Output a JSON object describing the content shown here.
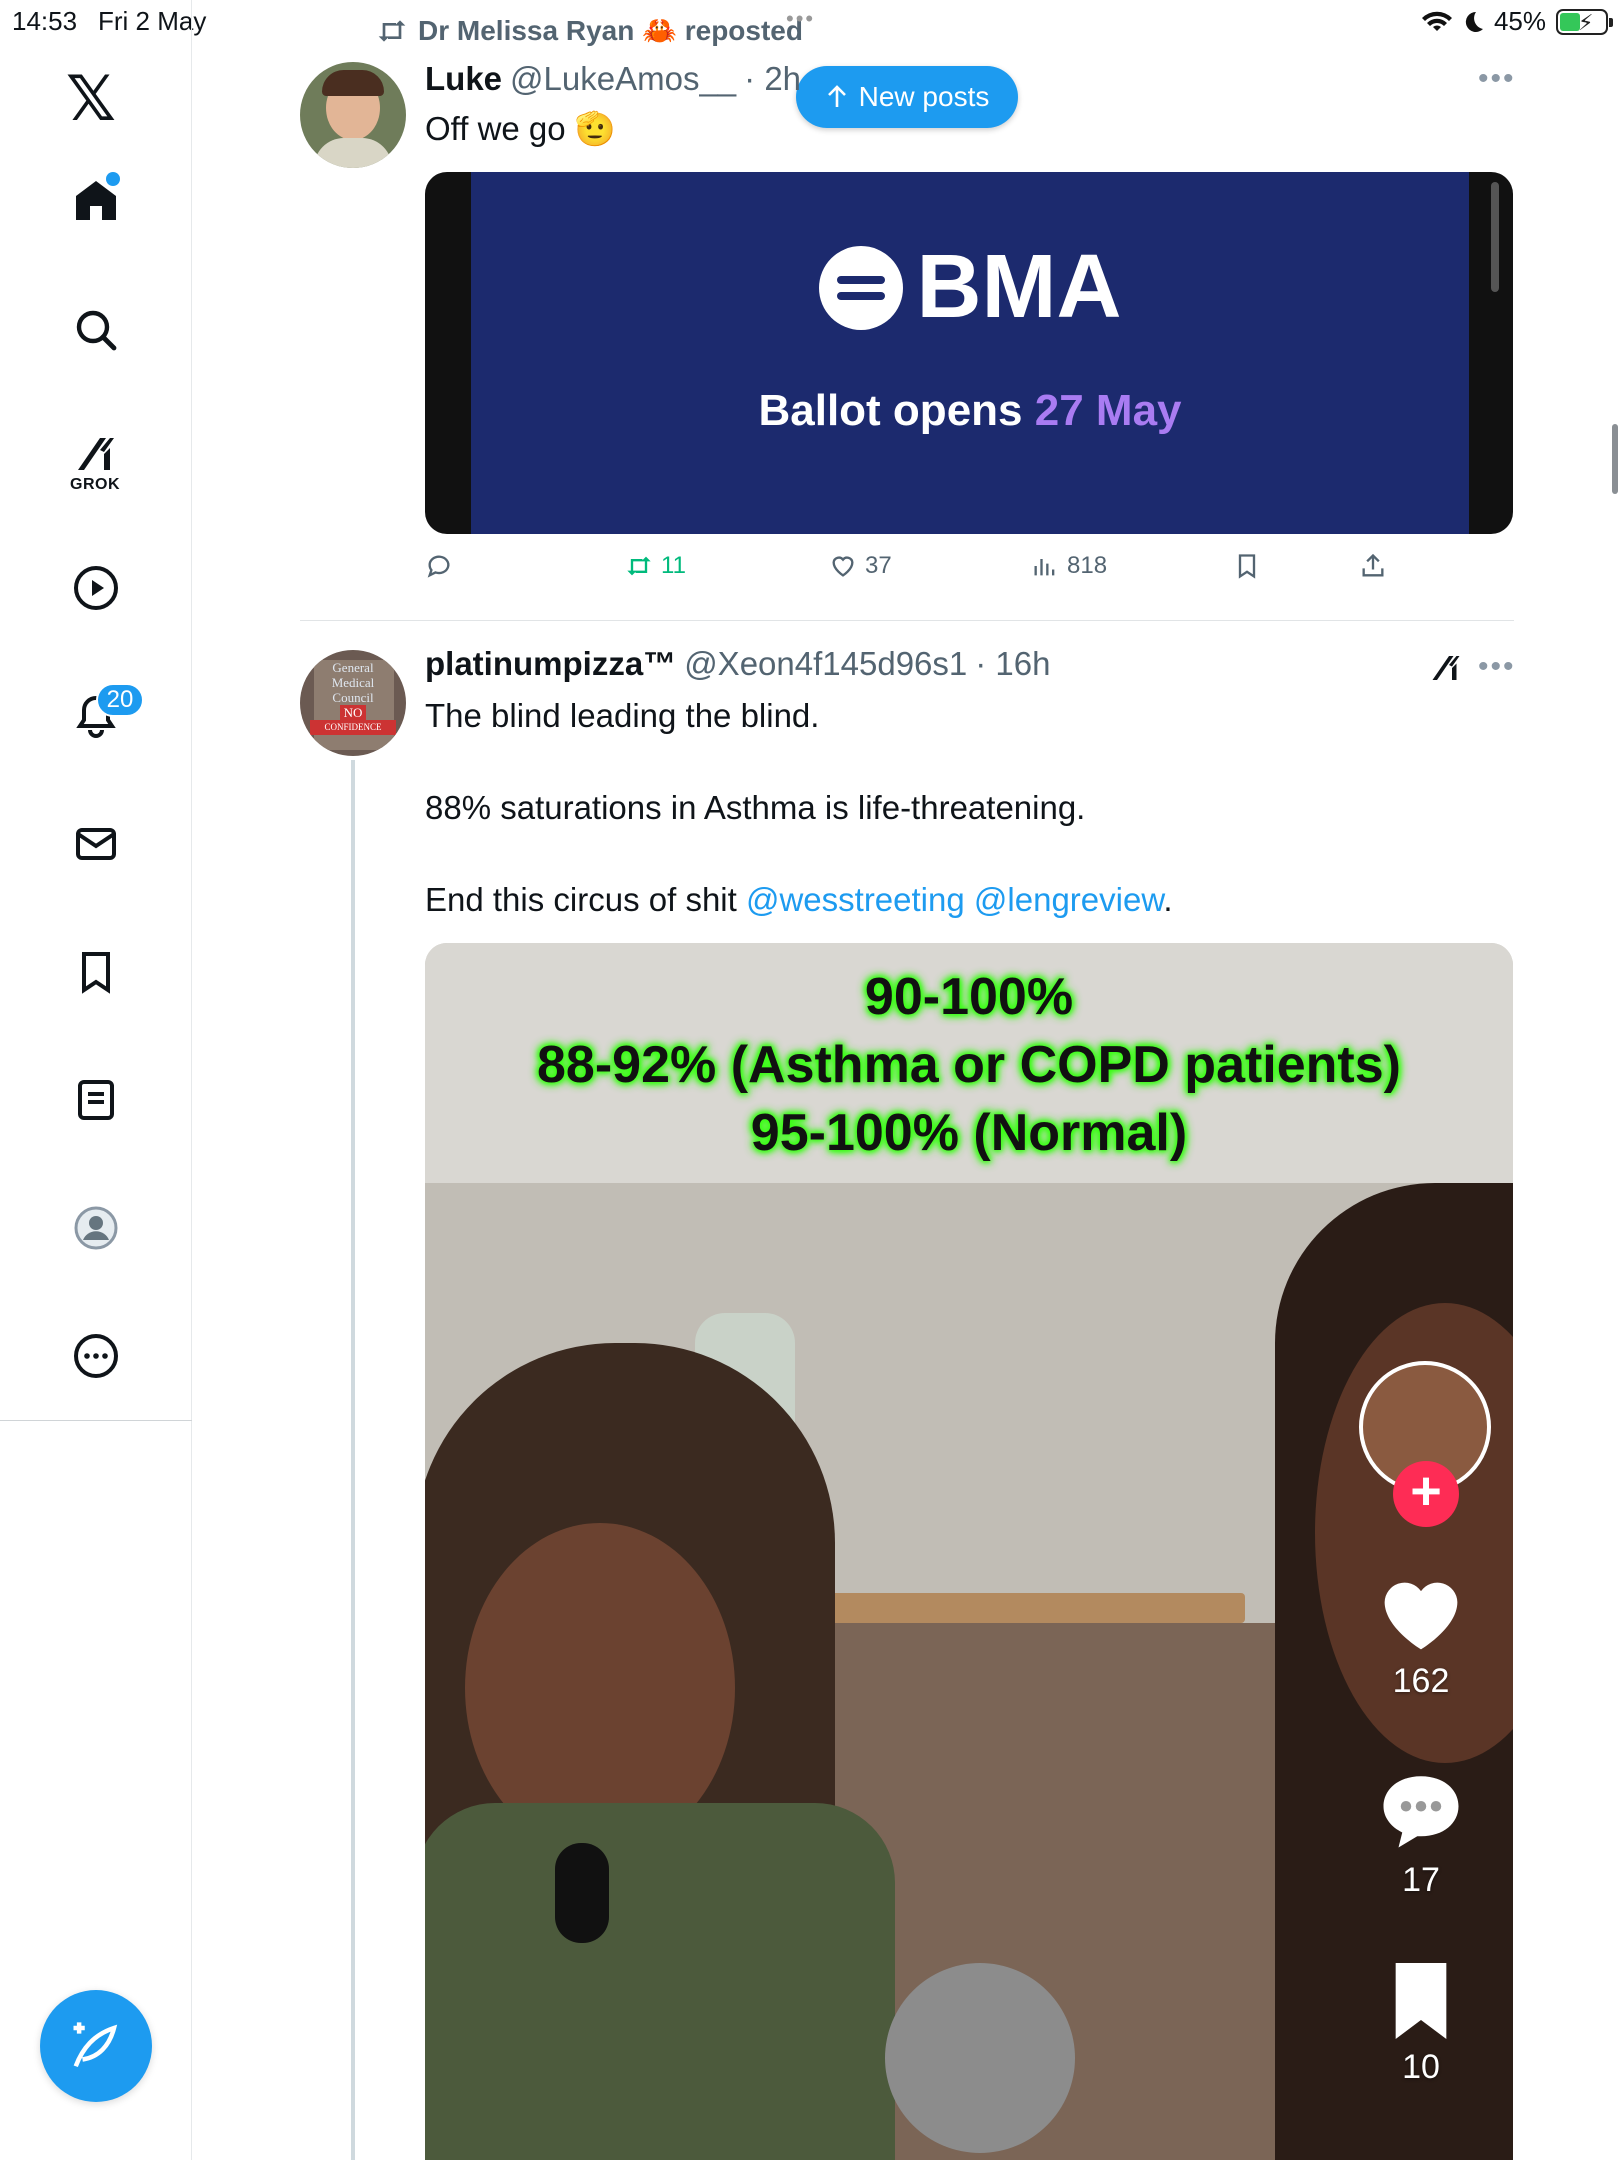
{
  "status_bar": {
    "time": "14:53",
    "date": "Fri 2 May",
    "battery": "45%"
  },
  "nav": {
    "grok_label": "GROK",
    "notifications_badge": "20",
    "icons": [
      "x-logo-icon",
      "home-icon",
      "search-icon",
      "grok-icon",
      "video-icon",
      "notifications-icon",
      "messages-icon",
      "bookmarks-icon",
      "lists-icon",
      "profile-icon",
      "more-icon"
    ]
  },
  "colors": {
    "accent": "#1d9bf0",
    "retweet_green": "#00ba7c",
    "neon_green": "#39ff14",
    "tiktok_red": "#fe2c55",
    "bma_blue": "#1c2a6e"
  },
  "repost_banner": {
    "text": "Dr Melissa Ryan 🦀 reposted"
  },
  "new_posts_button": "New posts",
  "post1": {
    "display_name": "Luke",
    "handle": "@LukeAmos__",
    "time": "· 2h",
    "text": "Off we go 🫡",
    "image": {
      "logo": "BMA",
      "line_prefix": "Ballot opens",
      "line_highlight": "27 May"
    },
    "stats": {
      "retweets": "11",
      "likes": "37",
      "views": "818"
    }
  },
  "post2": {
    "display_name": "platinumpizza™",
    "handle": "@Xeon4f145d96s1",
    "time": "· 16h",
    "line1": "The blind leading the blind.",
    "line2": "88% saturations in Asthma is life-threatening.",
    "line3_prefix": "End this circus of shit",
    "mention1": "@wesstreeting",
    "mention2": "@lengreview",
    "line3_suffix": ".",
    "avatar_text": [
      "General",
      "Medical",
      "Council",
      "NO",
      "CONFIDENCE"
    ],
    "video_overlay": [
      "90-100%",
      "88-92% (Asthma or COPD patients)",
      "95-100% (Normal)"
    ],
    "tiktok": {
      "likes": "162",
      "comments": "17",
      "saves": "10"
    }
  }
}
